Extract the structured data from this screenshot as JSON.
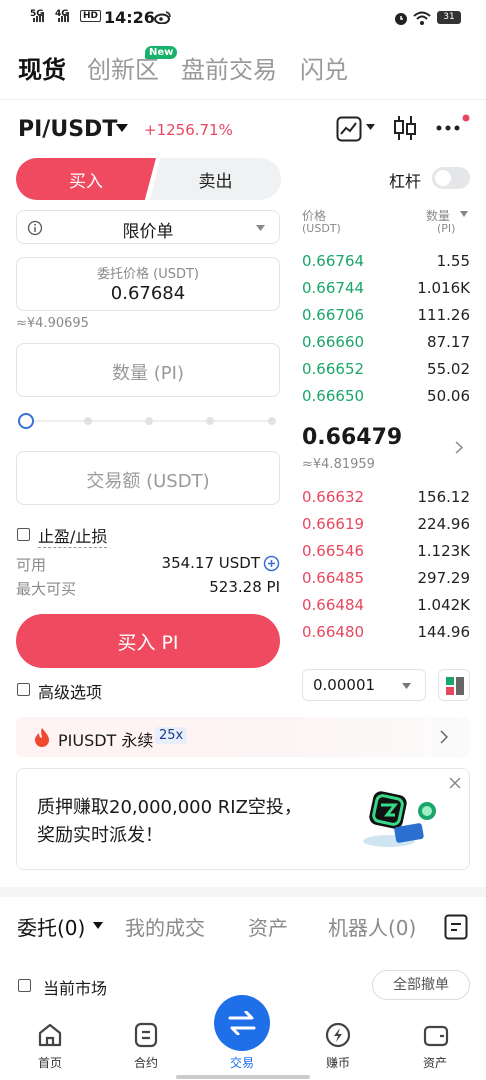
{
  "status": {
    "signal1": "5G",
    "signal2": "4G",
    "hd": "HD",
    "time": "14:26",
    "battery": "31"
  },
  "top_tabs": [
    {
      "label": "现货",
      "active": true
    },
    {
      "label": "创新区",
      "badge": "New"
    },
    {
      "label": "盘前交易"
    },
    {
      "label": "闪兑"
    }
  ],
  "header": {
    "pair": "PI/USDT",
    "change": "+1256.71%"
  },
  "order": {
    "buy_label": "买入",
    "sell_label": "卖出",
    "leverage_label": "杠杆",
    "order_type": "限价单",
    "price_label": "委托价格 (USDT)",
    "price_value": "0.67684",
    "price_cny": "≈¥4.90695",
    "qty_placeholder": "数量 (PI)",
    "amount_placeholder": "交易额 (USDT)",
    "tpsl_label": "止盈/止损",
    "available_label": "可用",
    "available_value": "354.17 USDT",
    "maxbuy_label": "最大可买",
    "maxbuy_value": "523.28 PI",
    "submit_label": "买入 PI",
    "advanced_label": "高级选项"
  },
  "orderbook": {
    "price_header": "价格",
    "price_unit": "(USDT)",
    "qty_header": "数量",
    "qty_unit": "(PI)",
    "asks": [
      {
        "price": "0.66764",
        "qty": "1.55"
      },
      {
        "price": "0.66744",
        "qty": "1.016K"
      },
      {
        "price": "0.66706",
        "qty": "111.26"
      },
      {
        "price": "0.66660",
        "qty": "87.17"
      },
      {
        "price": "0.66652",
        "qty": "55.02"
      },
      {
        "price": "0.66650",
        "qty": "50.06"
      }
    ],
    "last_price": "0.66479",
    "last_cny": "≈¥4.81959",
    "bids": [
      {
        "price": "0.66632",
        "qty": "156.12"
      },
      {
        "price": "0.66619",
        "qty": "224.96"
      },
      {
        "price": "0.66546",
        "qty": "1.123K"
      },
      {
        "price": "0.66485",
        "qty": "297.29"
      },
      {
        "price": "0.66484",
        "qty": "1.042K"
      },
      {
        "price": "0.66480",
        "qty": "144.96"
      }
    ],
    "precision": "0.00001"
  },
  "perp_banner": {
    "label": "PIUSDT 永续",
    "leverage": "25x"
  },
  "promo": {
    "line1": "质押赚取20,000,000 RIZ空投，",
    "line2": "奖励实时派发！"
  },
  "bottom_tabs": [
    {
      "label": "委托(0)",
      "active": true
    },
    {
      "label": "我的成交"
    },
    {
      "label": "资产"
    },
    {
      "label": "机器人(0)"
    }
  ],
  "current_market_label": "当前市场",
  "cancel_all_label": "全部撤单",
  "nav": [
    {
      "label": "首页"
    },
    {
      "label": "合约"
    },
    {
      "label": "交易",
      "active": true
    },
    {
      "label": "赚币"
    },
    {
      "label": "资产"
    }
  ],
  "colors": {
    "buy": "#ef4a5f",
    "ask_green": "#1aa66a",
    "bid_red": "#e8485f",
    "nav_active": "#1e6fe8"
  }
}
